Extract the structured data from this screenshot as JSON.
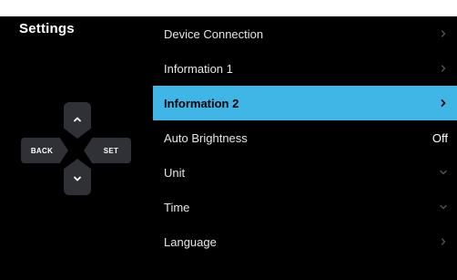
{
  "screen": {
    "title": "Settings"
  },
  "dpad": {
    "back_label": "BACK",
    "set_label": "SET",
    "up_icon": "chevron-up-icon",
    "down_icon": "chevron-down-icon"
  },
  "menu": {
    "selected_index": 2,
    "accent_color": "#3fb6e6",
    "items": [
      {
        "label": "Device Connection",
        "value": "",
        "icon": "chevron-right-icon"
      },
      {
        "label": "Information 1",
        "value": "",
        "icon": "chevron-right-icon"
      },
      {
        "label": "Information 2",
        "value": "",
        "icon": "chevron-right-icon"
      },
      {
        "label": "Auto Brightness",
        "value": "Off",
        "icon": ""
      },
      {
        "label": "Unit",
        "value": "",
        "icon": "chevron-down-icon"
      },
      {
        "label": "Time",
        "value": "",
        "icon": "chevron-down-icon"
      },
      {
        "label": "Language",
        "value": "",
        "icon": "chevron-right-icon"
      }
    ]
  }
}
